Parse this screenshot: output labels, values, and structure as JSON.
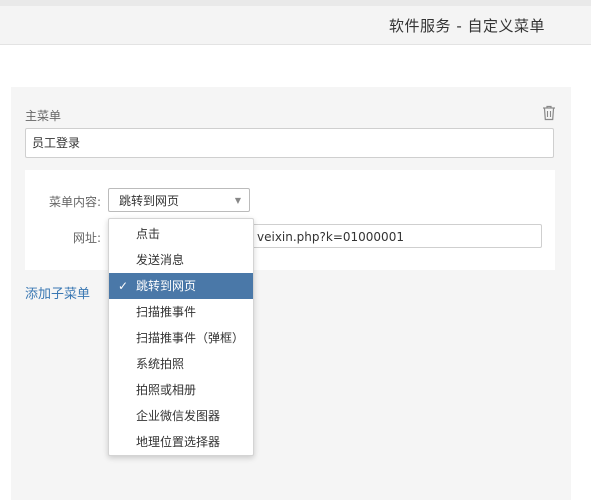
{
  "header": {
    "title": "软件服务 - 自定义菜单"
  },
  "menu": {
    "label": "主菜单",
    "value": "员工登录"
  },
  "content": {
    "label": "菜单内容:",
    "selected": "跳转到网页",
    "url_label": "网址:",
    "url_value": "veixin.php?k=01000001"
  },
  "dropdown": {
    "options": [
      "点击",
      "发送消息",
      "跳转到网页",
      "扫描推事件",
      "扫描推事件（弹框）",
      "系统拍照",
      "拍照或相册",
      "企业微信发图器",
      "地理位置选择器"
    ],
    "selected_index": 2
  },
  "add_submenu": "添加子菜单",
  "colors": {
    "accent": "#3a78b3",
    "selected_bg": "#4a78a8"
  },
  "icons": {
    "delete": "trash-icon",
    "dropdown": "caret-down-icon",
    "selected": "check-icon"
  }
}
